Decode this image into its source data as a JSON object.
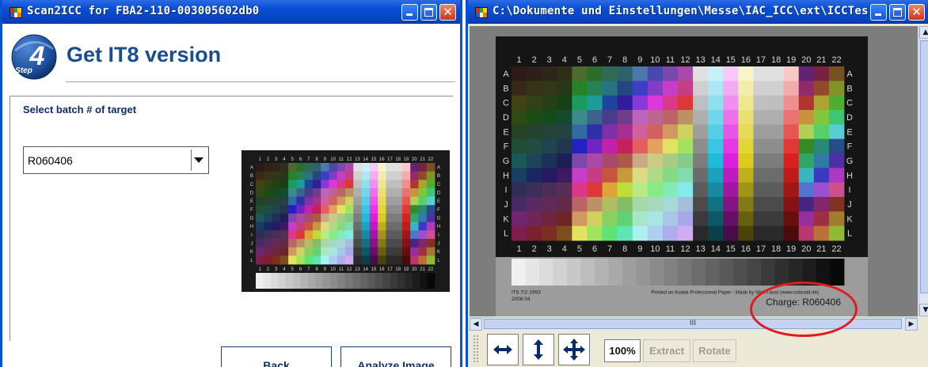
{
  "left_window": {
    "title": "Scan2ICC for FBA2-110-003005602db0",
    "step_number": "4",
    "step_word": "Step",
    "page_title": "Get IT8 version",
    "select_label": "Select batch # of target",
    "batch_value": "R060406",
    "back_label": "Back",
    "analyze_label": "Analyze Image"
  },
  "right_window": {
    "title": "C:\\Dokumente und Einstellungen\\Messe\\IAC_ICC\\ext\\ICCTestIma...",
    "hscroll_grip": "III",
    "toolbar": {
      "zoom_label": "100%",
      "extract_label": "Extract",
      "rotate_label": "Rotate"
    }
  },
  "it8_target": {
    "column_numbers": [
      "1",
      "2",
      "3",
      "4",
      "5",
      "6",
      "7",
      "8",
      "9",
      "10",
      "11",
      "12",
      "13",
      "14",
      "15",
      "16",
      "17",
      "18",
      "19",
      "20",
      "21",
      "22"
    ],
    "row_letters": [
      "A",
      "B",
      "C",
      "D",
      "E",
      "F",
      "G",
      "H",
      "I",
      "J",
      "K",
      "L"
    ],
    "footer_left_line1": "IT8.7/2-1993",
    "footer_left_line2": "2006:04",
    "footer_center": "Printed on Kodak Professional Paper  -  Made by Wolf Faust (www.coloraid.de)",
    "charge_text": "Charge: R060406"
  },
  "colors": {
    "titlebar_blue": "#0a4fd6",
    "heading_blue": "#1a4d8f",
    "highlight_red": "#e11b1b"
  }
}
